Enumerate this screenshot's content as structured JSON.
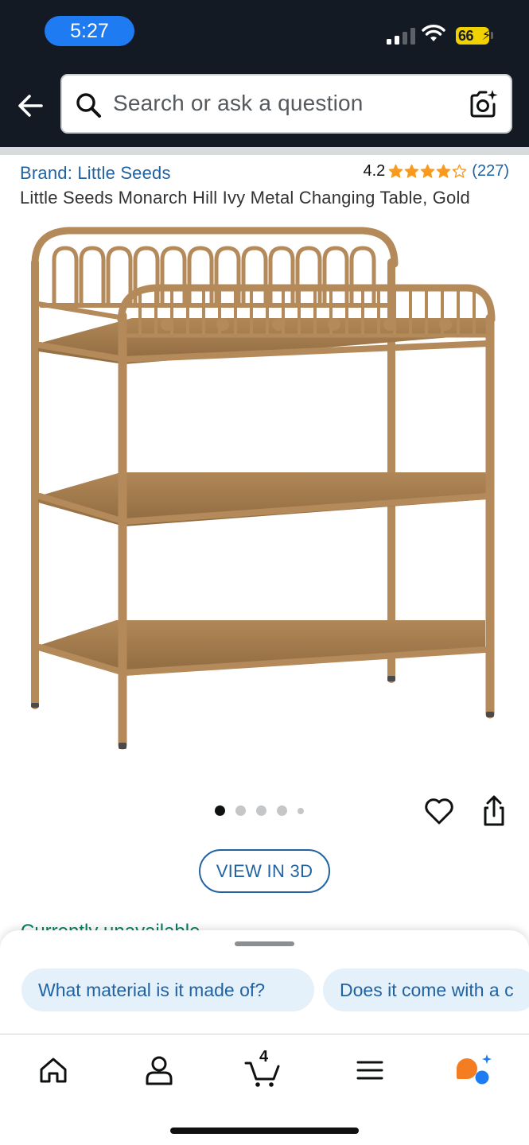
{
  "status_bar": {
    "time": "5:27",
    "battery": "66",
    "icons": [
      "signal-icon",
      "wifi-icon",
      "battery-icon"
    ]
  },
  "header": {
    "back_icon": "back-arrow-icon",
    "search_placeholder": "Search or ask a question",
    "search_icon": "search-icon",
    "lens_icon": "camera-lens-icon"
  },
  "product": {
    "brand": "Brand: Little Seeds",
    "rating": "4.2",
    "stars": 4.2,
    "review_count": "(227)",
    "title": "Little Seeds Monarch Hill Ivy Metal Changing Table, Gold"
  },
  "carousel": {
    "image_count": 5,
    "active_index": 0
  },
  "actions": {
    "favorite_icon": "heart-icon",
    "share_icon": "share-icon",
    "view_3d": "VIEW IN 3D"
  },
  "peek_text": "Currently unavailable.",
  "suggestions": [
    "What material is it made of?",
    "Does it come with a c"
  ],
  "bottom_nav": {
    "items": [
      "home-icon",
      "account-icon",
      "cart-icon",
      "menu-icon",
      "rufus-icon"
    ],
    "cart_count": "4"
  },
  "colors": {
    "header_bg": "#141a24",
    "link": "#2162a1",
    "star": "#f79a1f",
    "product_gold": "#b48a5a",
    "chip_bg": "#e4f1fb",
    "time_pill": "#1f7bf2",
    "battery": "#f2d100"
  }
}
